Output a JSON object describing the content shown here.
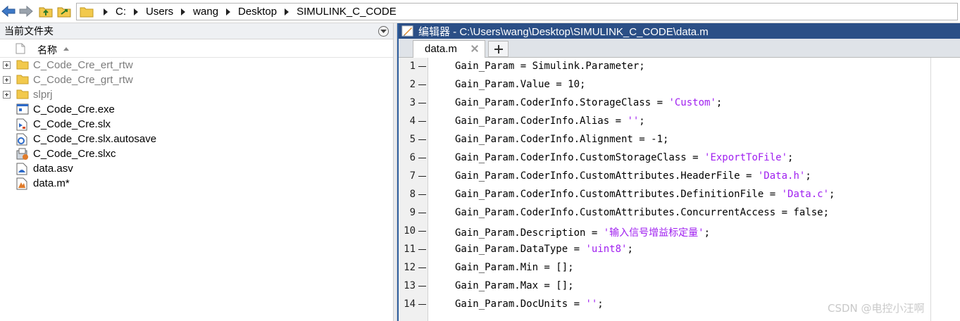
{
  "address_bar": {
    "path": [
      "C:",
      "Users",
      "wang",
      "Desktop",
      "SIMULINK_C_CODE"
    ]
  },
  "left_panel": {
    "title": "当前文件夹",
    "column_name": "名称",
    "files": [
      {
        "name": "C_Code_Cre_ert_rtw",
        "kind": "folder",
        "expandable": true,
        "dim": true
      },
      {
        "name": "C_Code_Cre_grt_rtw",
        "kind": "folder",
        "expandable": true,
        "dim": true
      },
      {
        "name": "slprj",
        "kind": "folder",
        "expandable": true,
        "dim": true
      },
      {
        "name": "C_Code_Cre.exe",
        "kind": "exe",
        "expandable": false,
        "dim": false
      },
      {
        "name": "C_Code_Cre.slx",
        "kind": "slx",
        "expandable": false,
        "dim": false
      },
      {
        "name": "C_Code_Cre.slx.autosave",
        "kind": "autosave",
        "expandable": false,
        "dim": false
      },
      {
        "name": "C_Code_Cre.slxc",
        "kind": "slxc",
        "expandable": false,
        "dim": false
      },
      {
        "name": "data.asv",
        "kind": "asv",
        "expandable": false,
        "dim": false
      },
      {
        "name": "data.m*",
        "kind": "mfile",
        "expandable": false,
        "dim": false
      }
    ]
  },
  "editor": {
    "title": "编辑器 - C:\\Users\\wang\\Desktop\\SIMULINK_C_CODE\\data.m",
    "tab_label": "data.m",
    "lines": [
      [
        {
          "t": "Gain_Param = Simulink.Parameter;"
        }
      ],
      [
        {
          "t": "Gain_Param.Value = 10;"
        }
      ],
      [
        {
          "t": "Gain_Param.CoderInfo.StorageClass = "
        },
        {
          "t": "'Custom'",
          "s": 1
        },
        {
          "t": ";"
        }
      ],
      [
        {
          "t": "Gain_Param.CoderInfo.Alias = "
        },
        {
          "t": "''",
          "s": 1
        },
        {
          "t": ";"
        }
      ],
      [
        {
          "t": "Gain_Param.CoderInfo.Alignment = -1;"
        }
      ],
      [
        {
          "t": "Gain_Param.CoderInfo.CustomStorageClass = "
        },
        {
          "t": "'ExportToFile'",
          "s": 1
        },
        {
          "t": ";"
        }
      ],
      [
        {
          "t": "Gain_Param.CoderInfo.CustomAttributes.HeaderFile = "
        },
        {
          "t": "'Data.h'",
          "s": 1
        },
        {
          "t": ";"
        }
      ],
      [
        {
          "t": "Gain_Param.CoderInfo.CustomAttributes.DefinitionFile = "
        },
        {
          "t": "'Data.c'",
          "s": 1
        },
        {
          "t": ";"
        }
      ],
      [
        {
          "t": "Gain_Param.CoderInfo.CustomAttributes.ConcurrentAccess = false;"
        }
      ],
      [
        {
          "t": "Gain_Param.Description = "
        },
        {
          "t": "'输入信号增益标定量'",
          "s": 1
        },
        {
          "t": ";"
        }
      ],
      [
        {
          "t": "Gain_Param.DataType = "
        },
        {
          "t": "'uint8'",
          "s": 1
        },
        {
          "t": ";"
        }
      ],
      [
        {
          "t": "Gain_Param.Min = [];"
        }
      ],
      [
        {
          "t": "Gain_Param.Max = [];"
        }
      ],
      [
        {
          "t": "Gain_Param.DocUnits = "
        },
        {
          "t": "''",
          "s": 1
        },
        {
          "t": ";"
        }
      ]
    ]
  },
  "watermark": "CSDN @电控小汪啊",
  "colors": {
    "title_bar": "#2b4f86",
    "string_literal": "#a020f0",
    "folder": "#f2c94c"
  }
}
